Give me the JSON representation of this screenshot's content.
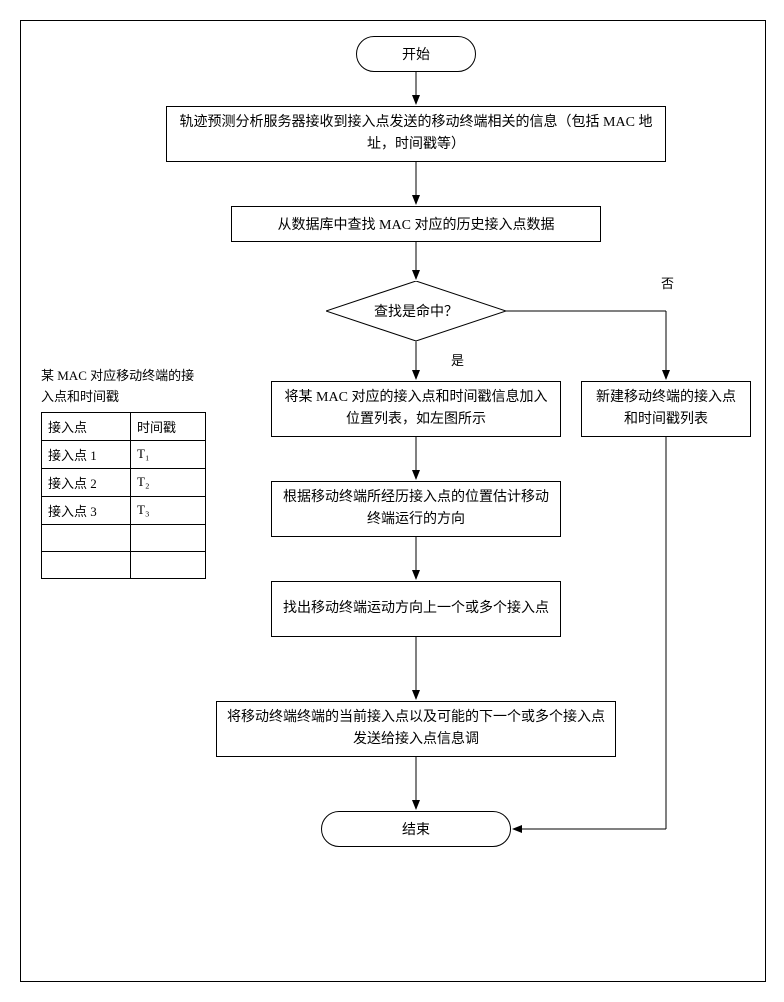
{
  "flowchart": {
    "start": "开始",
    "step1": "轨迹预测分析服务器接收到接入点发送的移动终端相关的信息（包括 MAC 地址，时间戳等）",
    "step2": "从数据库中查找 MAC 对应的历史接入点数据",
    "decision": "查找是命中？",
    "yes_label": "是",
    "no_label": "否",
    "step3_yes": "将某 MAC 对应的接入点和时间戳信息加入位置列表，如左图所示",
    "step3_no": "新建移动终端的接入点和时间戳列表",
    "step4": "根据移动终端所经历接入点的位置估计移动终端运行的方向",
    "step5": "找出移动终端运动方向上一个或多个接入点",
    "step6": "将移动终端终端的当前接入点以及可能的下一个或多个接入点发送给接入点信息调",
    "end": "结束"
  },
  "table": {
    "caption": "某 MAC 对应移动终端的接入点和时间戳",
    "headers": {
      "col1": "接入点",
      "col2": "时间戳"
    },
    "rows": [
      {
        "ap": "接入点 1",
        "ts": "T₁"
      },
      {
        "ap": "接入点 2",
        "ts": "T₂"
      },
      {
        "ap": "接入点 3",
        "ts": "T₃"
      },
      {
        "ap": "",
        "ts": ""
      },
      {
        "ap": "",
        "ts": ""
      }
    ]
  }
}
